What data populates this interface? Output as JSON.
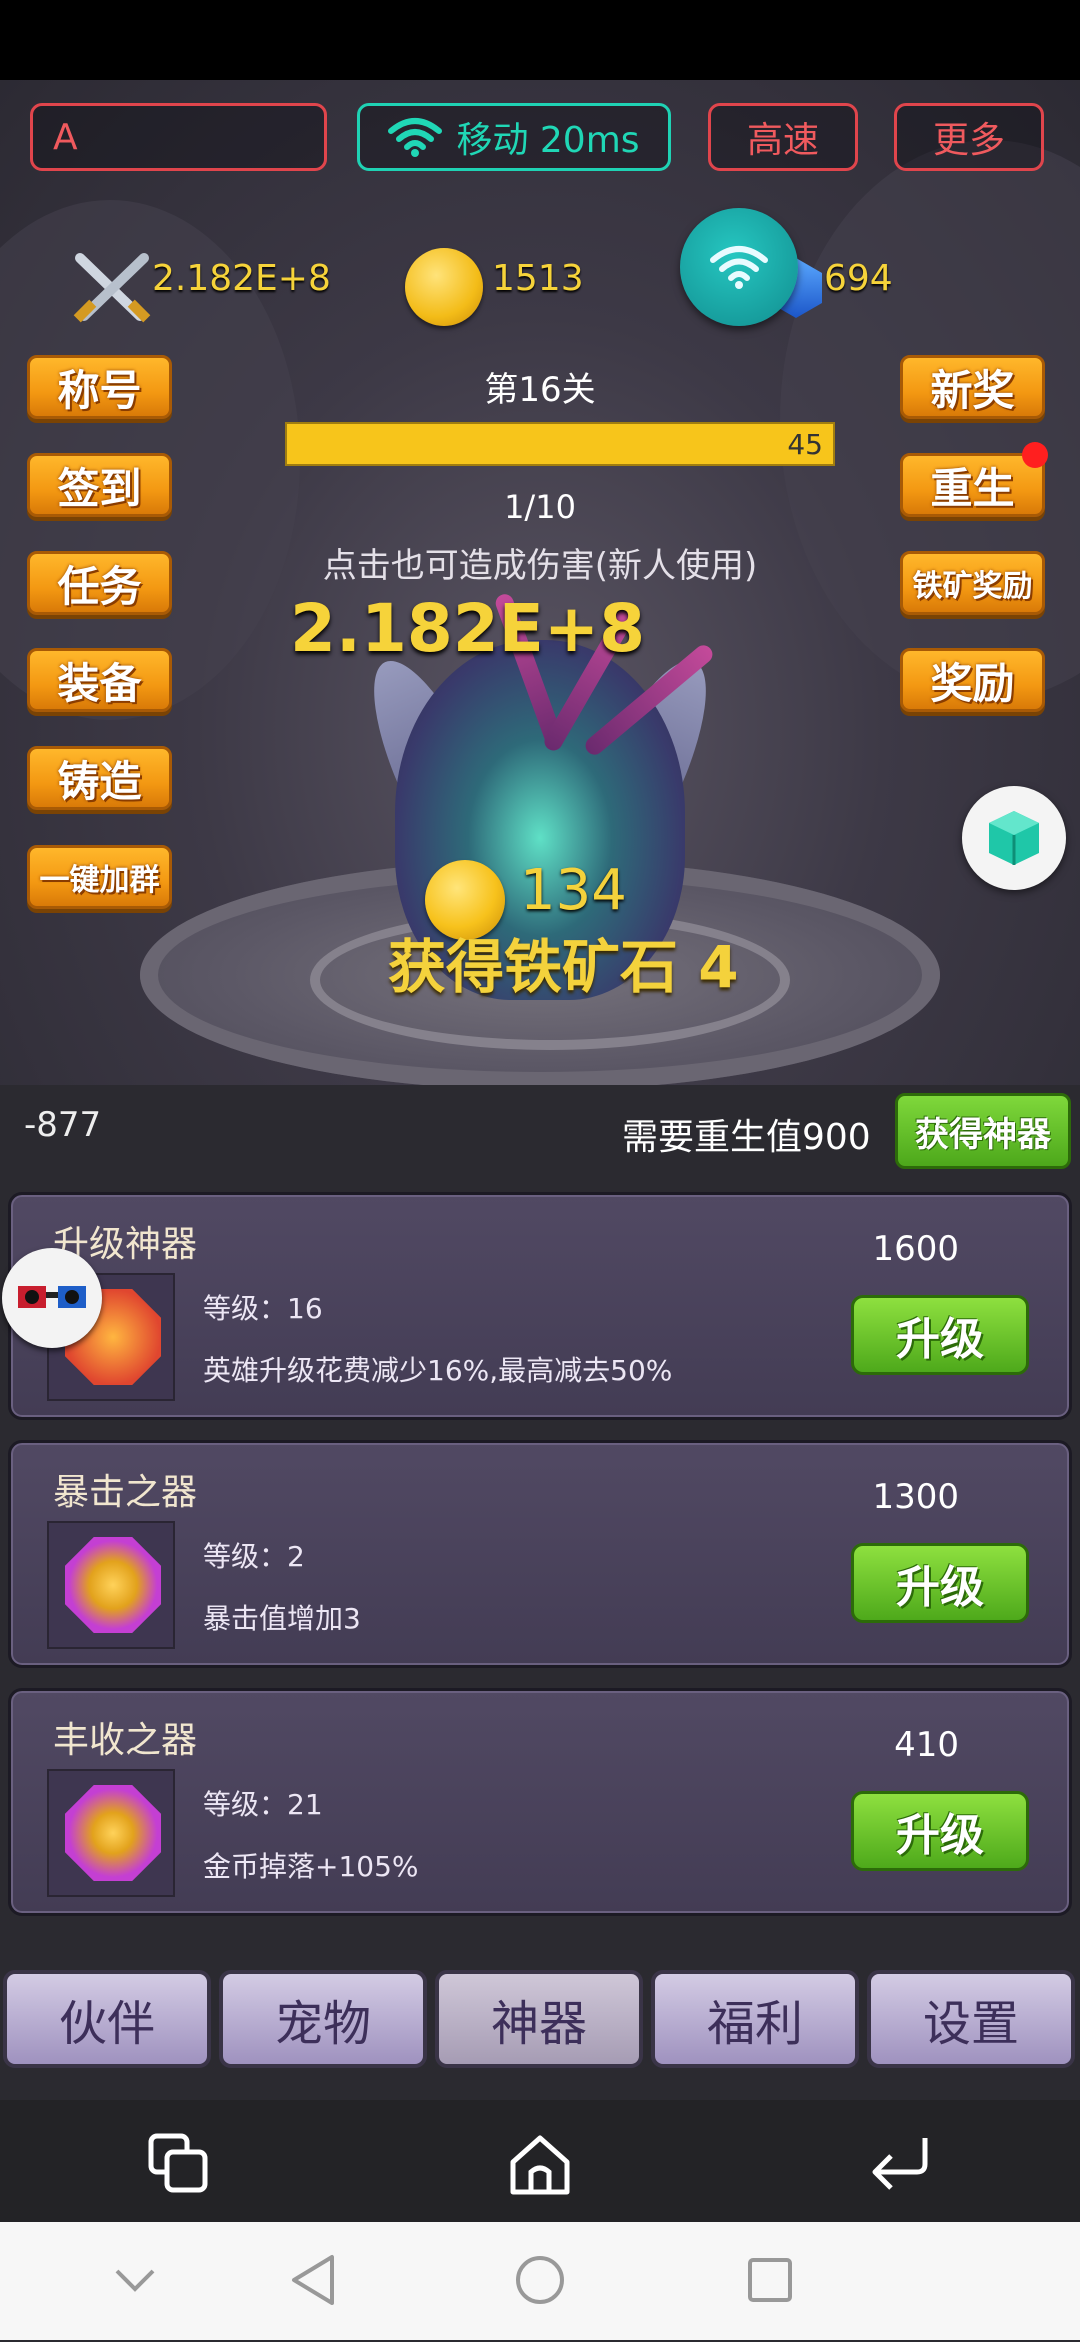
{
  "top_controls": {
    "input_value": "A",
    "network_label": "移动 20ms",
    "speed_label": "高速",
    "more_label": "更多"
  },
  "stats": {
    "power": "2.182E+8",
    "gold": "1513",
    "gems": "694"
  },
  "left_buttons": [
    "称号",
    "签到",
    "任务",
    "装备",
    "铸造",
    "一键加群"
  ],
  "right_buttons": [
    "新奖",
    "重生",
    "铁矿奖励",
    "奖励"
  ],
  "level": {
    "title": "第16关",
    "hp_value": "45",
    "hp_fraction": 1.0,
    "wave": "1/10",
    "tap_tip": "点击也可造成伤害(新人使用)",
    "damage": "2.182E+8",
    "coin_gain": "134",
    "ore_gain": "获得铁矿石 4"
  },
  "rebirth": {
    "left_value": "-877",
    "need_text": "需要重生值900",
    "get_button": "获得神器"
  },
  "artifacts": [
    {
      "name": "升级神器",
      "cost": "1600",
      "level": "等级：16",
      "desc": "英雄升级花费减少16%,最高减去50%",
      "button": "升级",
      "icon_color": "#e0462f"
    },
    {
      "name": "暴击之器",
      "cost": "1300",
      "level": "等级：2",
      "desc": "暴击值增加3",
      "button": "升级",
      "icon_color": "#c43fd3"
    },
    {
      "name": "丰收之器",
      "cost": "410",
      "level": "等级：21",
      "desc": "金币掉落+105%",
      "button": "升级",
      "icon_color": "#c43fd3"
    }
  ],
  "tabs": [
    "伙伴",
    "宠物",
    "神器",
    "福利",
    "设置"
  ],
  "active_tab": "神器",
  "icons": {
    "swords": "crossed-swords-icon",
    "gold": "gold-coin-icon",
    "gem": "blue-gem-icon",
    "wifi": "wifi-icon",
    "cube": "cube-icon",
    "notification_dot_color": "#ff1f1f"
  }
}
